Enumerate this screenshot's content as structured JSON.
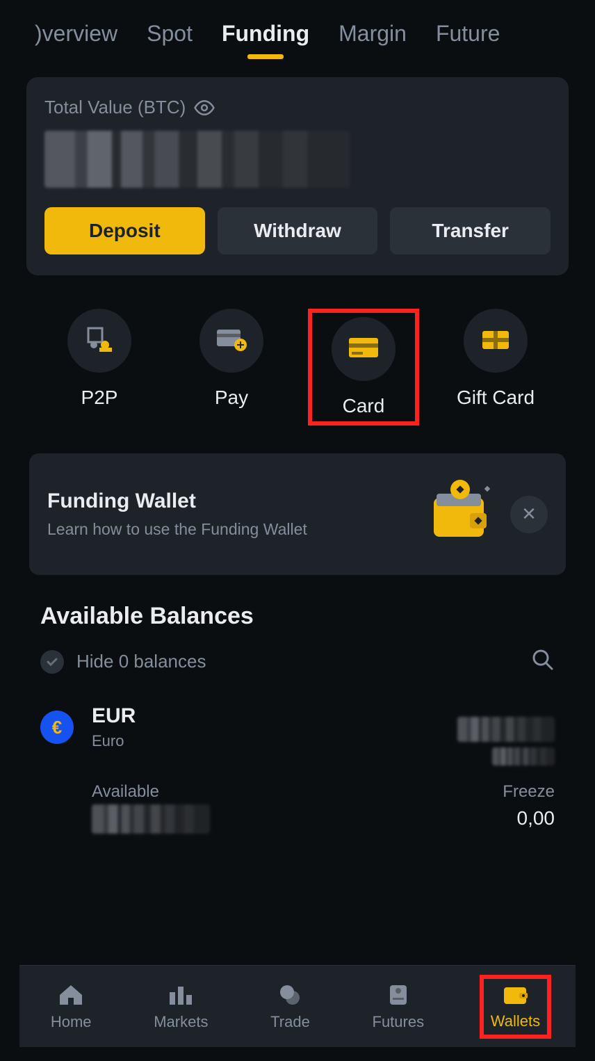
{
  "tabs": {
    "overview": ")verview",
    "spot": "Spot",
    "funding": "Funding",
    "margin": "Margin",
    "futures": "Future"
  },
  "panel": {
    "total_label": "Total Value (BTC)",
    "deposit": "Deposit",
    "withdraw": "Withdraw",
    "transfer": "Transfer"
  },
  "quick": {
    "p2p": "P2P",
    "pay": "Pay",
    "card": "Card",
    "gift": "Gift Card"
  },
  "banner": {
    "title": "Funding Wallet",
    "subtitle": "Learn how to use the Funding Wallet"
  },
  "balances": {
    "section_title": "Available Balances",
    "hide_label": "Hide 0 balances",
    "asset": {
      "symbol": "EUR",
      "name": "Euro",
      "euro_glyph": "€",
      "available_label": "Available",
      "freeze_label": "Freeze",
      "freeze_value": "0,00"
    }
  },
  "nav": {
    "home": "Home",
    "markets": "Markets",
    "trade": "Trade",
    "futures": "Futures",
    "wallets": "Wallets"
  }
}
